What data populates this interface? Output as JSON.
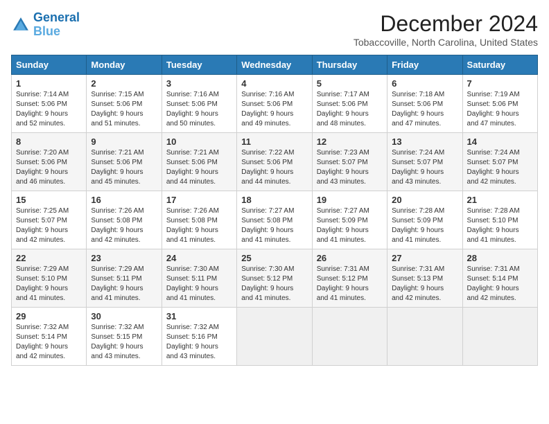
{
  "logo": {
    "line1": "General",
    "line2": "Blue"
  },
  "title": "December 2024",
  "location": "Tobaccoville, North Carolina, United States",
  "days_of_week": [
    "Sunday",
    "Monday",
    "Tuesday",
    "Wednesday",
    "Thursday",
    "Friday",
    "Saturday"
  ],
  "weeks": [
    [
      {
        "day": "1",
        "info": "Sunrise: 7:14 AM\nSunset: 5:06 PM\nDaylight: 9 hours\nand 52 minutes."
      },
      {
        "day": "2",
        "info": "Sunrise: 7:15 AM\nSunset: 5:06 PM\nDaylight: 9 hours\nand 51 minutes."
      },
      {
        "day": "3",
        "info": "Sunrise: 7:16 AM\nSunset: 5:06 PM\nDaylight: 9 hours\nand 50 minutes."
      },
      {
        "day": "4",
        "info": "Sunrise: 7:16 AM\nSunset: 5:06 PM\nDaylight: 9 hours\nand 49 minutes."
      },
      {
        "day": "5",
        "info": "Sunrise: 7:17 AM\nSunset: 5:06 PM\nDaylight: 9 hours\nand 48 minutes."
      },
      {
        "day": "6",
        "info": "Sunrise: 7:18 AM\nSunset: 5:06 PM\nDaylight: 9 hours\nand 47 minutes."
      },
      {
        "day": "7",
        "info": "Sunrise: 7:19 AM\nSunset: 5:06 PM\nDaylight: 9 hours\nand 47 minutes."
      }
    ],
    [
      {
        "day": "8",
        "info": "Sunrise: 7:20 AM\nSunset: 5:06 PM\nDaylight: 9 hours\nand 46 minutes."
      },
      {
        "day": "9",
        "info": "Sunrise: 7:21 AM\nSunset: 5:06 PM\nDaylight: 9 hours\nand 45 minutes."
      },
      {
        "day": "10",
        "info": "Sunrise: 7:21 AM\nSunset: 5:06 PM\nDaylight: 9 hours\nand 44 minutes."
      },
      {
        "day": "11",
        "info": "Sunrise: 7:22 AM\nSunset: 5:06 PM\nDaylight: 9 hours\nand 44 minutes."
      },
      {
        "day": "12",
        "info": "Sunrise: 7:23 AM\nSunset: 5:07 PM\nDaylight: 9 hours\nand 43 minutes."
      },
      {
        "day": "13",
        "info": "Sunrise: 7:24 AM\nSunset: 5:07 PM\nDaylight: 9 hours\nand 43 minutes."
      },
      {
        "day": "14",
        "info": "Sunrise: 7:24 AM\nSunset: 5:07 PM\nDaylight: 9 hours\nand 42 minutes."
      }
    ],
    [
      {
        "day": "15",
        "info": "Sunrise: 7:25 AM\nSunset: 5:07 PM\nDaylight: 9 hours\nand 42 minutes."
      },
      {
        "day": "16",
        "info": "Sunrise: 7:26 AM\nSunset: 5:08 PM\nDaylight: 9 hours\nand 42 minutes."
      },
      {
        "day": "17",
        "info": "Sunrise: 7:26 AM\nSunset: 5:08 PM\nDaylight: 9 hours\nand 41 minutes."
      },
      {
        "day": "18",
        "info": "Sunrise: 7:27 AM\nSunset: 5:08 PM\nDaylight: 9 hours\nand 41 minutes."
      },
      {
        "day": "19",
        "info": "Sunrise: 7:27 AM\nSunset: 5:09 PM\nDaylight: 9 hours\nand 41 minutes."
      },
      {
        "day": "20",
        "info": "Sunrise: 7:28 AM\nSunset: 5:09 PM\nDaylight: 9 hours\nand 41 minutes."
      },
      {
        "day": "21",
        "info": "Sunrise: 7:28 AM\nSunset: 5:10 PM\nDaylight: 9 hours\nand 41 minutes."
      }
    ],
    [
      {
        "day": "22",
        "info": "Sunrise: 7:29 AM\nSunset: 5:10 PM\nDaylight: 9 hours\nand 41 minutes."
      },
      {
        "day": "23",
        "info": "Sunrise: 7:29 AM\nSunset: 5:11 PM\nDaylight: 9 hours\nand 41 minutes."
      },
      {
        "day": "24",
        "info": "Sunrise: 7:30 AM\nSunset: 5:11 PM\nDaylight: 9 hours\nand 41 minutes."
      },
      {
        "day": "25",
        "info": "Sunrise: 7:30 AM\nSunset: 5:12 PM\nDaylight: 9 hours\nand 41 minutes."
      },
      {
        "day": "26",
        "info": "Sunrise: 7:31 AM\nSunset: 5:12 PM\nDaylight: 9 hours\nand 41 minutes."
      },
      {
        "day": "27",
        "info": "Sunrise: 7:31 AM\nSunset: 5:13 PM\nDaylight: 9 hours\nand 42 minutes."
      },
      {
        "day": "28",
        "info": "Sunrise: 7:31 AM\nSunset: 5:14 PM\nDaylight: 9 hours\nand 42 minutes."
      }
    ],
    [
      {
        "day": "29",
        "info": "Sunrise: 7:32 AM\nSunset: 5:14 PM\nDaylight: 9 hours\nand 42 minutes."
      },
      {
        "day": "30",
        "info": "Sunrise: 7:32 AM\nSunset: 5:15 PM\nDaylight: 9 hours\nand 43 minutes."
      },
      {
        "day": "31",
        "info": "Sunrise: 7:32 AM\nSunset: 5:16 PM\nDaylight: 9 hours\nand 43 minutes."
      },
      null,
      null,
      null,
      null
    ]
  ]
}
